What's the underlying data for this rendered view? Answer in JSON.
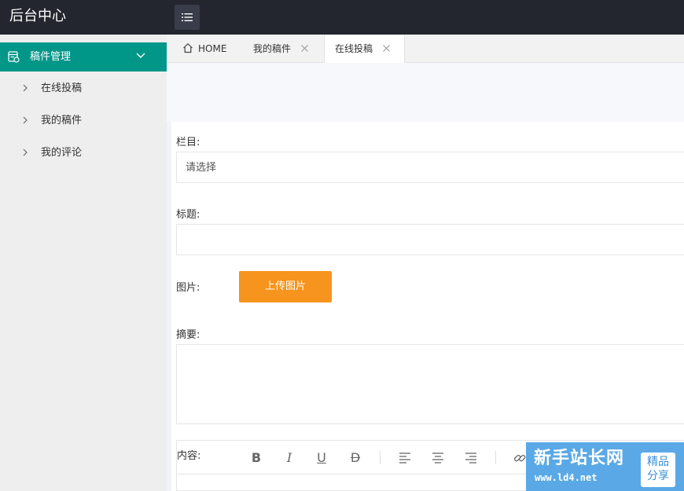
{
  "header": {
    "logo": "后台中心"
  },
  "sidebar": {
    "group": {
      "label": "稿件管理"
    },
    "items": [
      {
        "label": "在线投稿"
      },
      {
        "label": "我的稿件"
      },
      {
        "label": "我的评论"
      }
    ]
  },
  "tabs": [
    {
      "label": "HOME",
      "closable": false
    },
    {
      "label": "我的稿件",
      "closable": true
    },
    {
      "label": "在线投稿",
      "closable": true,
      "active": true
    }
  ],
  "form": {
    "category": {
      "label": "栏目:",
      "placeholder": "请选择"
    },
    "title": {
      "label": "标题:",
      "value": ""
    },
    "image": {
      "label": "图片:",
      "upload_button": "上传图片"
    },
    "summary": {
      "label": "摘要:",
      "value": ""
    },
    "content": {
      "label": "内容:"
    }
  },
  "editor_toolbar": [
    "bold-icon",
    "italic-icon",
    "underline-icon",
    "strikethrough-icon",
    "align-left-icon",
    "align-center-icon",
    "align-right-icon",
    "link-icon"
  ],
  "watermark": {
    "title": "新手站长网",
    "url": "www.ld4.net",
    "badge_line1": "精品",
    "badge_line2": "分享"
  },
  "colors": {
    "header_bg": "#23262e",
    "accent": "#009688",
    "upload_button": "#f7941d",
    "watermark_bg": "#5aa9e6"
  }
}
